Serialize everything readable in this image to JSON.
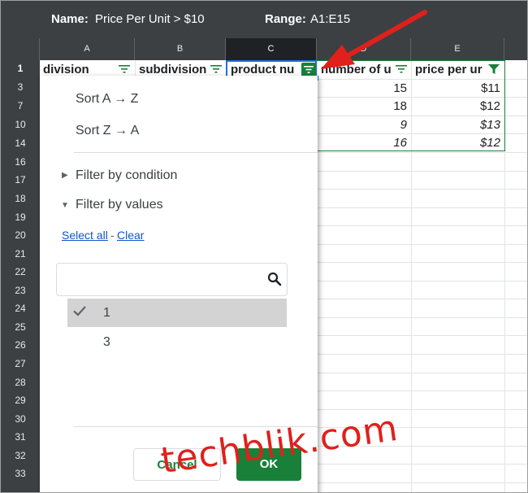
{
  "filter_view": {
    "name_label": "Name:",
    "name_value": "Price Per Unit > $10",
    "range_label": "Range:",
    "range_value": "A1:E15"
  },
  "columns": [
    "A",
    "B",
    "C",
    "D",
    "E"
  ],
  "rows": [
    "1",
    "3",
    "7",
    "10",
    "14",
    "16",
    "17",
    "18",
    "19",
    "20",
    "21",
    "22",
    "23",
    "24",
    "25",
    "26",
    "27",
    "28",
    "29",
    "30",
    "31",
    "32",
    "33"
  ],
  "header_cells": {
    "a": "division",
    "b": "subdivision",
    "c": "product nu",
    "d": "number of u",
    "e": "price per ur"
  },
  "data_rows": [
    {
      "d": "15",
      "e": "$11",
      "italic": false
    },
    {
      "d": "18",
      "e": "$12",
      "italic": false
    },
    {
      "d": "9",
      "e": "$13",
      "italic": true
    },
    {
      "d": "16",
      "e": "$12",
      "italic": true
    }
  ],
  "filter_menu": {
    "sort_az": "Sort A → Z",
    "sort_za": "Sort Z → A",
    "filter_condition": "Filter by condition",
    "filter_values": "Filter by values",
    "select_all": "Select all",
    "separator": "-",
    "clear": "Clear",
    "search_placeholder": "",
    "values": [
      {
        "label": "1",
        "checked": true
      },
      {
        "label": "3",
        "checked": false
      }
    ],
    "cancel": "Cancel",
    "ok": "OK"
  },
  "watermark": "techblik.com",
  "colors": {
    "accent_green": "#188038",
    "selection_blue": "#1a73e8",
    "annotation_red": "#e0201b",
    "header_dark": "#3c4043"
  }
}
